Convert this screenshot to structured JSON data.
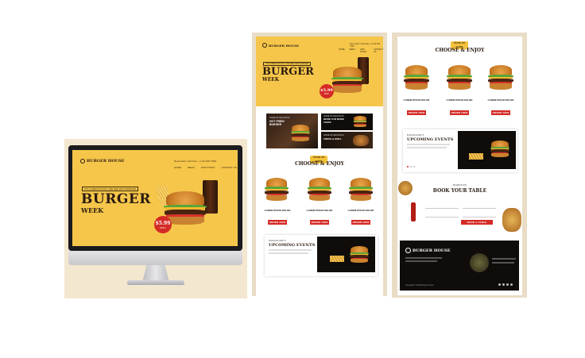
{
  "monitor": {
    "brand": "BURGER HOUSE",
    "contact": "Reservation Call Now: +1 123 456 7890",
    "nav": [
      "HOME",
      "MENU",
      "OUR STORY",
      "CONTACT US"
    ],
    "tagline": "IT'S A NEW FUN DAY THE SEE FAST BURGER",
    "headline": "BURGER",
    "subheadline": "WEEK",
    "price": "$5.99",
    "price_note": "ONLY"
  },
  "page_middle": {
    "brand": "BURGER HOUSE",
    "contact": "Reservation Call Now: +1 123 456 7890",
    "nav": [
      "HOME",
      "MENU",
      "OUR STORY",
      "CONTACT US"
    ],
    "tagline": "IT'S A NEW FUN DAY THE SEE FAST BURGER",
    "headline": "BURGER",
    "subheadline": "WEEK",
    "price": "$5.99",
    "price_note": "ONLY",
    "promos": [
      {
        "small": "SOME OF DELICIOUS",
        "title": "HOT FRIED BURGER"
      },
      {
        "small": "SOME OF DELICIOUS",
        "title": "MORE FUN MORE TASTE"
      },
      {
        "small": "SOME OF DELICIOUS",
        "title": "FRESH & GRILL"
      }
    ],
    "menu_pill": "TASTE OF FOOD",
    "menu_title": "CHOOSE & ENJOY",
    "menu_items": [
      {
        "name": "LOREM IPSUM DOLOR",
        "button": "ORDER NOW"
      },
      {
        "name": "LOREM IPSUM DOLOR",
        "button": "ORDER NOW"
      },
      {
        "name": "LOREM IPSUM DOLOR",
        "button": "ORDER NOW"
      }
    ],
    "events_small": "BURGER EVENTS",
    "events_title": "UPCOMING EVENTS"
  },
  "page_right": {
    "menu_pill": "TASTE OF FOOD",
    "menu_title": "CHOOSE & ENJOY",
    "menu_items": [
      {
        "name": "LOREM IPSUM DOLOR",
        "button": "ORDER NOW"
      },
      {
        "name": "LOREM IPSUM DOLOR",
        "button": "ORDER NOW"
      },
      {
        "name": "LOREM IPSUM DOLOR",
        "button": "ORDER NOW"
      }
    ],
    "events_small": "BURGER EVENTS",
    "events_title": "UPCOMING EVENTS",
    "book_small": "RESERVATION",
    "book_title": "BOOK YOUR TABLE",
    "book_button": "BOOK A TABLE",
    "footer_brand": "BURGER HOUSE",
    "footer_copy": "Copyright © 2020 Burger House"
  },
  "colors": {
    "yellow": "#f5c64a",
    "red": "#d42a26",
    "dark": "#0f0c0a",
    "brown_text": "#2a1a10"
  }
}
